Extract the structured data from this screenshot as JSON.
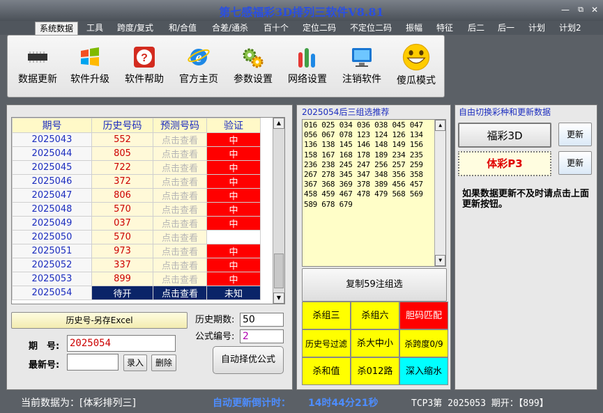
{
  "window": {
    "title": "第七感福彩3D排列三软件V8.81",
    "min_label": "—",
    "max_label": "⧉",
    "close_label": "✕"
  },
  "menu": [
    {
      "label": "系统数据"
    },
    {
      "label": "工具"
    },
    {
      "label": "跨度/复式"
    },
    {
      "label": "和/合值"
    },
    {
      "label": "合差/通杀"
    },
    {
      "label": "百十个"
    },
    {
      "label": "定位二码"
    },
    {
      "label": "不定位二码"
    },
    {
      "label": "振幅"
    },
    {
      "label": "特征"
    },
    {
      "label": "后二"
    },
    {
      "label": "后一"
    },
    {
      "label": "计划"
    },
    {
      "label": "计划2"
    }
  ],
  "ribbon": [
    {
      "label": "数据更新",
      "icon": "chip-icon"
    },
    {
      "label": "软件升级",
      "icon": "windows-logo-icon"
    },
    {
      "label": "软件帮助",
      "icon": "help-icon"
    },
    {
      "label": "官方主页",
      "icon": "ie-logo-icon"
    },
    {
      "label": "参数设置",
      "icon": "gear-icon"
    },
    {
      "label": "网络设置",
      "icon": "bars-icon"
    },
    {
      "label": "注销软件",
      "icon": "monitor-icon"
    },
    {
      "label": "傻瓜模式",
      "icon": "smiley-icon"
    }
  ],
  "grid": {
    "headers": [
      "期号",
      "历史号码",
      "预测号码",
      "验证"
    ],
    "rows": [
      {
        "issue": "2025043",
        "hist": "552",
        "pred": "点击查看",
        "verify": "中"
      },
      {
        "issue": "2025044",
        "hist": "805",
        "pred": "点击查看",
        "verify": "中"
      },
      {
        "issue": "2025045",
        "hist": "722",
        "pred": "点击查看",
        "verify": "中"
      },
      {
        "issue": "2025046",
        "hist": "372",
        "pred": "点击查看",
        "verify": "中"
      },
      {
        "issue": "2025047",
        "hist": "806",
        "pred": "点击查看",
        "verify": "中"
      },
      {
        "issue": "2025048",
        "hist": "570",
        "pred": "点击查看",
        "verify": "中"
      },
      {
        "issue": "2025049",
        "hist": "037",
        "pred": "点击查看",
        "verify": "中"
      },
      {
        "issue": "2025050",
        "hist": "570",
        "pred": "点击查看",
        "verify": ""
      },
      {
        "issue": "2025051",
        "hist": "973",
        "pred": "点击查看",
        "verify": "中"
      },
      {
        "issue": "2025052",
        "hist": "337",
        "pred": "点击查看",
        "verify": "中"
      },
      {
        "issue": "2025053",
        "hist": "899",
        "pred": "点击查看",
        "verify": "中"
      },
      {
        "issue": "2025054",
        "hist": "待开",
        "pred": "点击查看",
        "verify": "未知"
      }
    ]
  },
  "left": {
    "export_btn": "历史号-另存Excel",
    "issue_label": "期　号:",
    "issue_value": "2025054",
    "latest_label": "最新号:",
    "latest_value": "",
    "enter_btn": "录入",
    "delete_btn": "删除",
    "hist_count_label": "历史期数:",
    "hist_count_value": "50",
    "formula_label": "公式编号:",
    "formula_value": "2",
    "auto_btn": "自动择优公式"
  },
  "mid": {
    "group_title": "2025054后三组选推荐",
    "numbers": "016 025 034 036 038 045 047 056 067 078 123 124 126 134 136 138 145 146 148 149 156 158 167 168 178 189 234 235 236 238 245 247 256 257 259 267 278 345 347 348 356 358 367 368 369 378 389 456 457 458 459 467 478 479 568 569 589 678 679",
    "copy_btn": "复制59注组选",
    "cells": [
      {
        "label": "杀组三",
        "color": "#ffff00",
        "text": "#000000"
      },
      {
        "label": "杀组六",
        "color": "#ffff00",
        "text": "#000000"
      },
      {
        "label": "胆码匹配",
        "color": "#ff0000",
        "text": "#ffffff"
      },
      {
        "label": "历史号过滤",
        "color": "#ffff00",
        "text": "#000000"
      },
      {
        "label": "杀大中小",
        "color": "#ffff00",
        "text": "#000000"
      },
      {
        "label": "杀跨度0/9",
        "color": "#ffff00",
        "text": "#000000"
      },
      {
        "label": "杀和值",
        "color": "#ffff00",
        "text": "#000000"
      },
      {
        "label": "杀012路",
        "color": "#ffff00",
        "text": "#000000"
      },
      {
        "label": "深入缩水",
        "color": "#00ffff",
        "text": "#000000"
      }
    ]
  },
  "right": {
    "group_title": "自由切换彩种和更新数据",
    "lottery1": "福彩3D",
    "lottery2": "体彩P3",
    "update_btn": "更新",
    "note": "如果数据更新不及时请点击上面更新按钮。"
  },
  "status": {
    "current": "当前数据为：[体彩排列三]",
    "countdown_label": "自动更新倒计时：",
    "countdown": "14时44分21秒",
    "last": "TCP3第 2025053 期开：【899】"
  }
}
